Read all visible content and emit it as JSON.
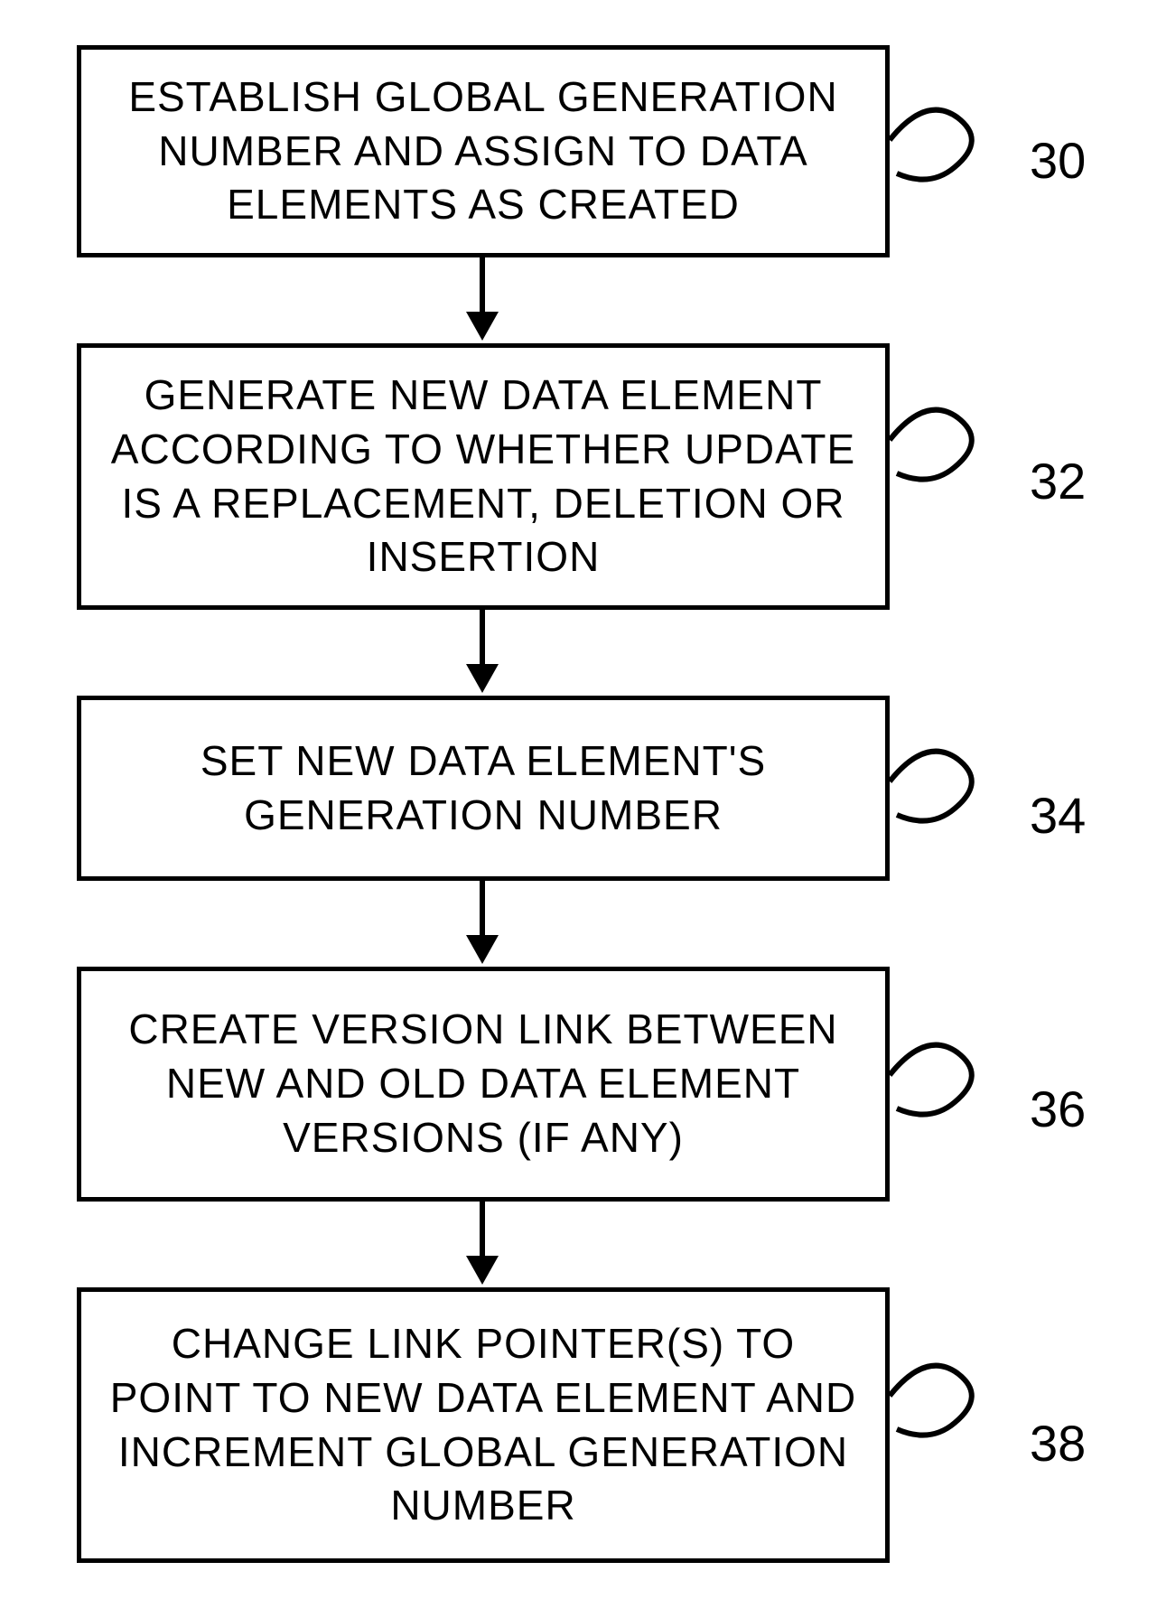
{
  "steps": [
    {
      "text": "ESTABLISH GLOBAL GENERATION NUMBER AND ASSIGN TO DATA ELEMENTS AS CREATED",
      "label": "30"
    },
    {
      "text": "GENERATE NEW DATA ELEMENT ACCORDING TO WHETHER UPDATE IS A REPLACEMENT, DELETION OR INSERTION",
      "label": "32"
    },
    {
      "text": "SET NEW DATA ELEMENT'S GENERATION NUMBER",
      "label": "34"
    },
    {
      "text": "CREATE VERSION LINK BETWEEN NEW AND OLD DATA ELEMENT VERSIONS (IF ANY)",
      "label": "36"
    },
    {
      "text": "CHANGE LINK POINTER(S) TO POINT TO NEW DATA ELEMENT AND INCREMENT GLOBAL GENERATION NUMBER",
      "label": "38"
    }
  ]
}
